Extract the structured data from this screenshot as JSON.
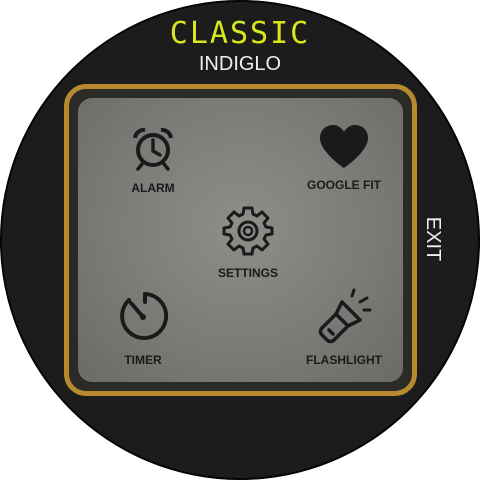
{
  "header": {
    "brand": "CLASSIC",
    "subbrand": "INDIGLO",
    "brand_color": "#d8e81a"
  },
  "menu": {
    "frame_color": "#b88a2e",
    "items": [
      {
        "id": "alarm",
        "label": "ALARM",
        "icon": "alarm-clock-icon"
      },
      {
        "id": "google_fit",
        "label": "GOOGLE FIT",
        "icon": "heart-icon"
      },
      {
        "id": "settings",
        "label": "SETTINGS",
        "icon": "gear-icon"
      },
      {
        "id": "timer",
        "label": "TIMER",
        "icon": "timer-icon"
      },
      {
        "id": "flashlight",
        "label": "FLASHLIGHT",
        "icon": "flashlight-icon"
      }
    ]
  },
  "exit": {
    "label": "EXIT"
  }
}
